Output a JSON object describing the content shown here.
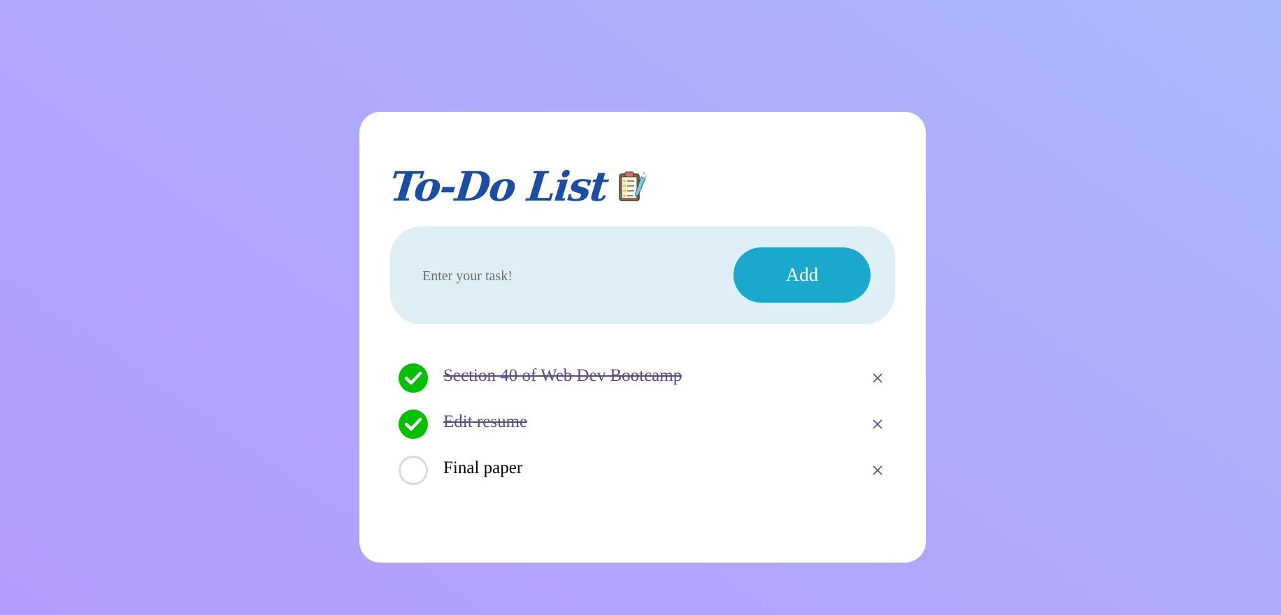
{
  "app": {
    "title": "To-Do List",
    "title_icon": "clipboard-checklist-icon"
  },
  "input": {
    "placeholder": "Enter your task!",
    "value": ""
  },
  "add_button": {
    "label": "Add"
  },
  "tasks": [
    {
      "text": "Section 40 of Web Dev Bootcamp",
      "completed": true
    },
    {
      "text": "Edit resume",
      "completed": true
    },
    {
      "text": "Final paper",
      "completed": false
    }
  ],
  "colors": {
    "title": "#1a4ea6",
    "accent": "#1aa8cc",
    "input_background": "#deeef5",
    "checked": "#00c000",
    "completed_text": "#5b4a8b",
    "delete_icon": "#5b4a8b"
  },
  "icons": {
    "checked": "check-circle-icon",
    "unchecked": "empty-circle-icon",
    "delete": "close-icon"
  }
}
